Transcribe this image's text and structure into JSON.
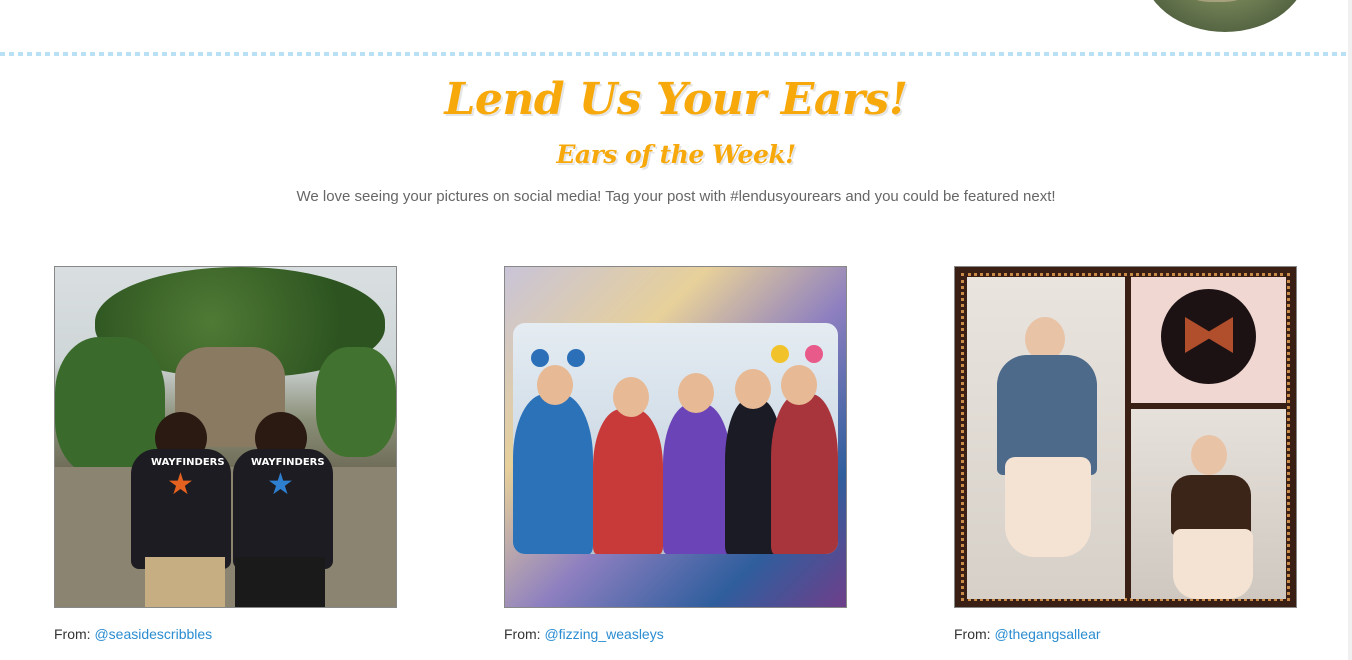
{
  "section": {
    "title": "Lend Us Your Ears!",
    "subtitle": "Ears of the Week!",
    "tagline": "We love seeing your pictures on social media! Tag your post with #lendusyourears and you could be featured next!"
  },
  "posts": [
    {
      "from_label": "From:",
      "handle": "@seasidescribbles",
      "photo_jacket_left": "WAYFINDERS",
      "photo_jacket_right": "WAYFINDERS"
    },
    {
      "from_label": "From:",
      "handle": "@fizzing_weasleys"
    },
    {
      "from_label": "From:",
      "handle": "@thegangsallear"
    }
  ],
  "colors": {
    "heading": "#f7a90c",
    "link": "#2a8cd1",
    "divider": "#b9e0f5",
    "body_text": "#666666"
  }
}
